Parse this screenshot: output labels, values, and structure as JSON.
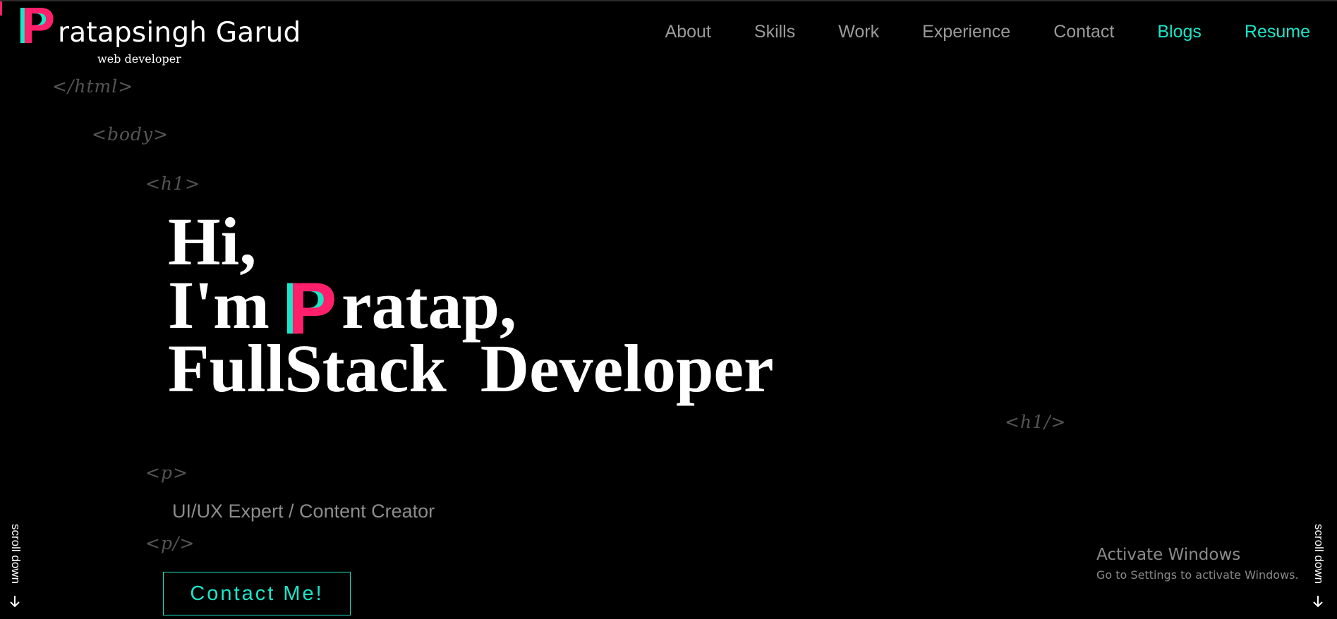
{
  "logo": {
    "initial": "P",
    "name_rest": "ratapsingh Garud",
    "subtitle": "web developer"
  },
  "nav": {
    "about": "About",
    "skills": "Skills",
    "work": "Work",
    "experience": "Experience",
    "contact": "Contact",
    "blogs": "Blogs",
    "resume": "Resume"
  },
  "tags": {
    "html_close": "</html>",
    "body_open": "<body>",
    "h1_open": "<h1>",
    "h1_close": "<h1/>",
    "p_open": "<p>",
    "p_close": "<p/>"
  },
  "hero": {
    "line1": "Hi,",
    "line2_prefix": "I'm ",
    "initial": "P",
    "line2_rest": "ratap,",
    "line3": "FullStack  Developer"
  },
  "subtitle": "UI/UX Expert / Content Creator",
  "contact_button": "Contact Me!",
  "scroll_down": "scroll down",
  "watermark": {
    "title": "Activate Windows",
    "subtitle": "Go to Settings to activate Windows."
  },
  "colors": {
    "background": "#000000",
    "accent_cyan": "#19e6c8",
    "accent_pink": "#ff1f6b",
    "nav_text": "#9a9a9a",
    "tag_text": "#555555"
  },
  "icons": {
    "scroll_arrow": "arrow-down-icon"
  }
}
